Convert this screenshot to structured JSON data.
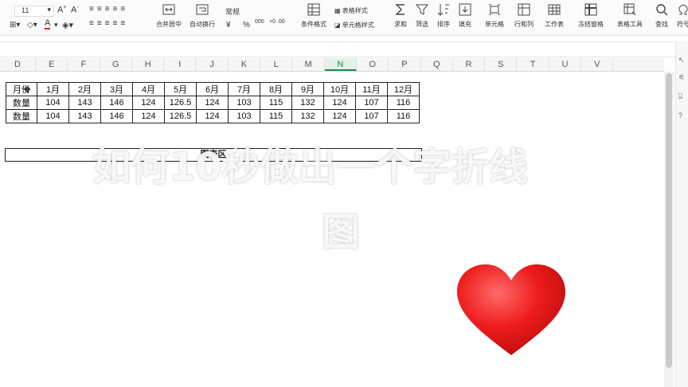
{
  "toolbar": {
    "font_size": "11",
    "number_format": "常规",
    "merge_label": "合并居中",
    "wrap_label": "自动换行",
    "currency_symbol": "¥",
    "percent_symbol": "%",
    "thousands_label": "000",
    "inc_decimal_label": "+0 .00",
    "dec_decimal_label": "-.00 +.0",
    "table_style_label": "表格样式",
    "cond_format_label": "条件格式",
    "cell_style_label": "单元格样式",
    "sum_label": "求和",
    "filter_label": "筛选",
    "sort_label": "排序",
    "fill_label": "填充",
    "cell_label": "单元格",
    "rowcol_label": "行和列",
    "sheet_label": "工作表",
    "freeze_label": "冻结窗格",
    "table_tools_label": "表格工具",
    "find_label": "查找",
    "symbol_label": "符号"
  },
  "columns": [
    "D",
    "E",
    "F",
    "G",
    "H",
    "I",
    "J",
    "K",
    "L",
    "M",
    "N",
    "O",
    "P",
    "Q",
    "R",
    "S",
    "T",
    "U",
    "V"
  ],
  "selected_column": "N",
  "table": {
    "header": [
      "月份",
      "1月",
      "2月",
      "3月",
      "4月",
      "5月",
      "6月",
      "7月",
      "8月",
      "9月",
      "10月",
      "11月",
      "12月"
    ],
    "rows": [
      [
        "数量",
        "104",
        "143",
        "146",
        "124",
        "126.5",
        "124",
        "103",
        "115",
        "132",
        "124",
        "107",
        "116"
      ],
      [
        "数量",
        "104",
        "143",
        "146",
        "124",
        "126.5",
        "124",
        "103",
        "115",
        "132",
        "124",
        "107",
        "116"
      ]
    ]
  },
  "chart_area_label": "图表区",
  "overlay": {
    "line1": "如何10秒做出一个字折线",
    "line2": "图"
  },
  "colors": {
    "accent": "#1f8a57",
    "heart": "#e8141b"
  },
  "icons": [
    "sum-icon",
    "filter-icon",
    "sort-icon",
    "fill-icon",
    "cell-icon",
    "rowcol-icon",
    "sheet-icon",
    "freeze-icon",
    "table-tools-icon",
    "search-icon",
    "cursor-icon",
    "heart-icon"
  ]
}
